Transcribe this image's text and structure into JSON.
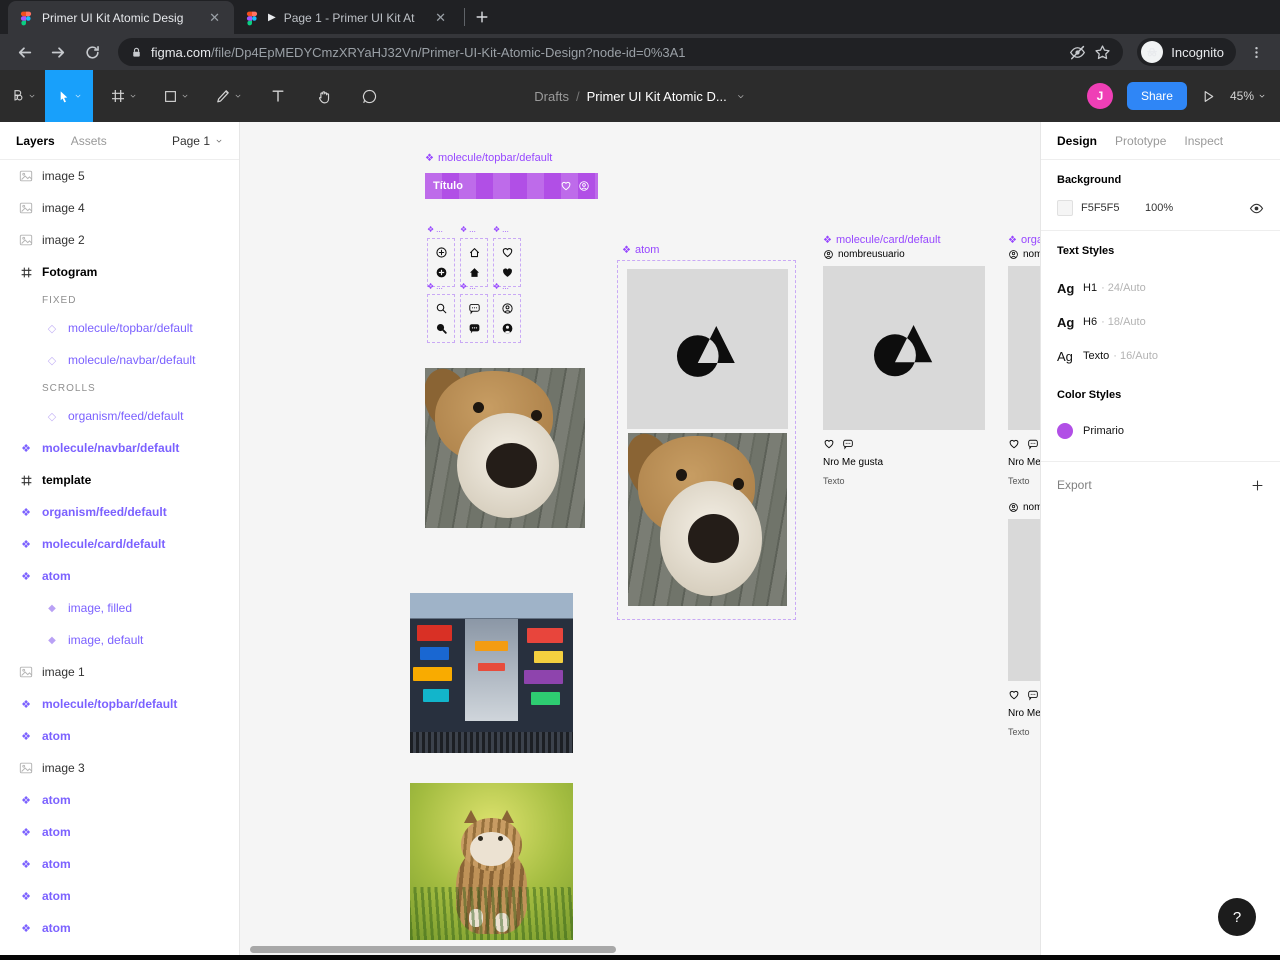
{
  "browser": {
    "tabs": [
      {
        "title": "Primer UI Kit Atomic Desig"
      },
      {
        "title": "Page 1 - Primer UI Kit At"
      }
    ],
    "url_domain": "figma.com",
    "url_path": "/file/Dp4EpMEDYCmzXRYaHJ32Vn/Primer-UI-Kit-Atomic-Design?node-id=0%3A1",
    "incognito_label": "Incognito"
  },
  "toolbar": {
    "breadcrumb_folder": "Drafts",
    "breadcrumb_separator": "/",
    "breadcrumb_file": "Primer UI Kit Atomic D...",
    "avatar_initial": "J",
    "share_label": "Share",
    "zoom_value": "45%"
  },
  "layers_panel": {
    "tab_layers": "Layers",
    "tab_assets": "Assets",
    "page_selector": "Page 1",
    "items": [
      {
        "label": "image 5"
      },
      {
        "label": "image 4"
      },
      {
        "label": "image 2"
      },
      {
        "label": "Fotogram"
      },
      {
        "label": "FIXED"
      },
      {
        "label": "molecule/topbar/default"
      },
      {
        "label": "molecule/navbar/default"
      },
      {
        "label": "SCROLLS"
      },
      {
        "label": "organism/feed/default"
      },
      {
        "label": "molecule/navbar/default"
      },
      {
        "label": "template"
      },
      {
        "label": "organism/feed/default"
      },
      {
        "label": "molecule/card/default"
      },
      {
        "label": "atom"
      },
      {
        "label": "image, filled"
      },
      {
        "label": "image, default"
      },
      {
        "label": "image 1"
      },
      {
        "label": "molecule/topbar/default"
      },
      {
        "label": "atom"
      },
      {
        "label": "image 3"
      },
      {
        "label": "atom"
      },
      {
        "label": "atom"
      },
      {
        "label": "atom"
      },
      {
        "label": "atom"
      },
      {
        "label": "atom"
      }
    ]
  },
  "canvas": {
    "topbar": {
      "label": "molecule/topbar/default",
      "title": "Título"
    },
    "icon_frame_label": "...",
    "icon_sets": [
      [
        "plus-circle-outline",
        "plus-circle-filled"
      ],
      [
        "home-outline",
        "home-filled"
      ],
      [
        "heart-outline",
        "heart-filled"
      ],
      [
        "search-outline",
        "search-filled"
      ],
      [
        "comment-outline",
        "comment-filled"
      ],
      [
        "person-circle-outline",
        "person-circle-filled"
      ]
    ],
    "atom": {
      "label": "atom"
    },
    "card": {
      "label": "molecule/card/default",
      "username": "nombreusuario",
      "likes_label": "Nro Me gusta",
      "text_label": "Texto"
    },
    "feed": {
      "label": "organism/feed/default",
      "username": "nombreusuario",
      "likes_label": "Nro Me gusta",
      "text_label": "Texto"
    }
  },
  "inspector": {
    "tabs": [
      {
        "label": "Design"
      },
      {
        "label": "Prototype"
      },
      {
        "label": "Inspect"
      }
    ],
    "background": {
      "title": "Background",
      "hex": "F5F5F5",
      "opacity": "100%"
    },
    "text_styles": {
      "title": "Text Styles",
      "sample": "Ag",
      "styles": [
        {
          "name": "H1",
          "detail": "· 24/Auto"
        },
        {
          "name": "H6",
          "detail": "· 18/Auto"
        },
        {
          "name": "Texto",
          "detail": "· 16/Auto"
        }
      ]
    },
    "color_styles": {
      "title": "Color Styles",
      "styles": [
        {
          "name": "Primario",
          "color": "#B14FE6"
        }
      ]
    },
    "export_label": "Export"
  },
  "help_label": "?",
  "colors": {
    "accent_blue": "#18A0FB",
    "share_blue": "#2F86F6",
    "avatar_pink": "#EF3FB6",
    "primario_purple": "#B14FE6",
    "component_purple": "#7B61FF",
    "canvas_component_purple": "#9747FF",
    "canvas_background": "#F5F5F5",
    "placeholder_gray": "#D9D9D9"
  }
}
